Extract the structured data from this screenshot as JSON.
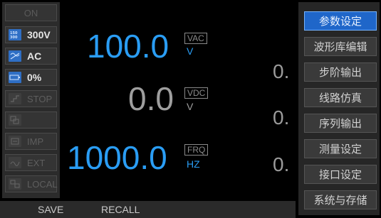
{
  "left_panel": {
    "on_label": "ON",
    "buttons": [
      {
        "label": "300V",
        "icon": "range-icon",
        "active": true
      },
      {
        "label": "AC",
        "icon": "ac-dc-icon",
        "active": true
      },
      {
        "label": "0%",
        "icon": "battery-icon",
        "active": true
      },
      {
        "label": "STOP",
        "icon": "step-icon",
        "active": false
      },
      {
        "label": "",
        "icon": "overlay-icon",
        "active": false
      },
      {
        "label": "IMP",
        "icon": "impedance-icon",
        "active": false
      },
      {
        "label": "EXT",
        "icon": "external-icon",
        "active": false
      },
      {
        "label": "LOCAL",
        "icon": "local-icon",
        "active": false
      }
    ]
  },
  "main": {
    "readings": [
      {
        "value": "100.0",
        "unit_box": "VAC",
        "unit": "V",
        "color": "#2a9df4"
      },
      {
        "value": "0.0",
        "unit_box": "VDC",
        "unit": "V",
        "color": "#9e9e9e"
      },
      {
        "value": "1000.0",
        "unit_box": "FRQ",
        "unit": "HZ",
        "color": "#2a9df4"
      }
    ],
    "right_values": [
      "0.",
      "0.",
      "0."
    ]
  },
  "menu": {
    "items": [
      {
        "label": "参数设定",
        "selected": true
      },
      {
        "label": "波形库编辑",
        "selected": false
      },
      {
        "label": "步阶输出",
        "selected": false
      },
      {
        "label": "线路仿真",
        "selected": false
      },
      {
        "label": "序列输出",
        "selected": false
      },
      {
        "label": "测量设定",
        "selected": false
      },
      {
        "label": "接口设定",
        "selected": false
      },
      {
        "label": "系统与存储",
        "selected": false
      }
    ]
  },
  "bottom_bar": {
    "save_label": "SAVE",
    "recall_label": "RECALL"
  },
  "colors": {
    "accent_blue": "#2a9df4",
    "menu_selected": "#1f66c9",
    "background": "#000000"
  }
}
